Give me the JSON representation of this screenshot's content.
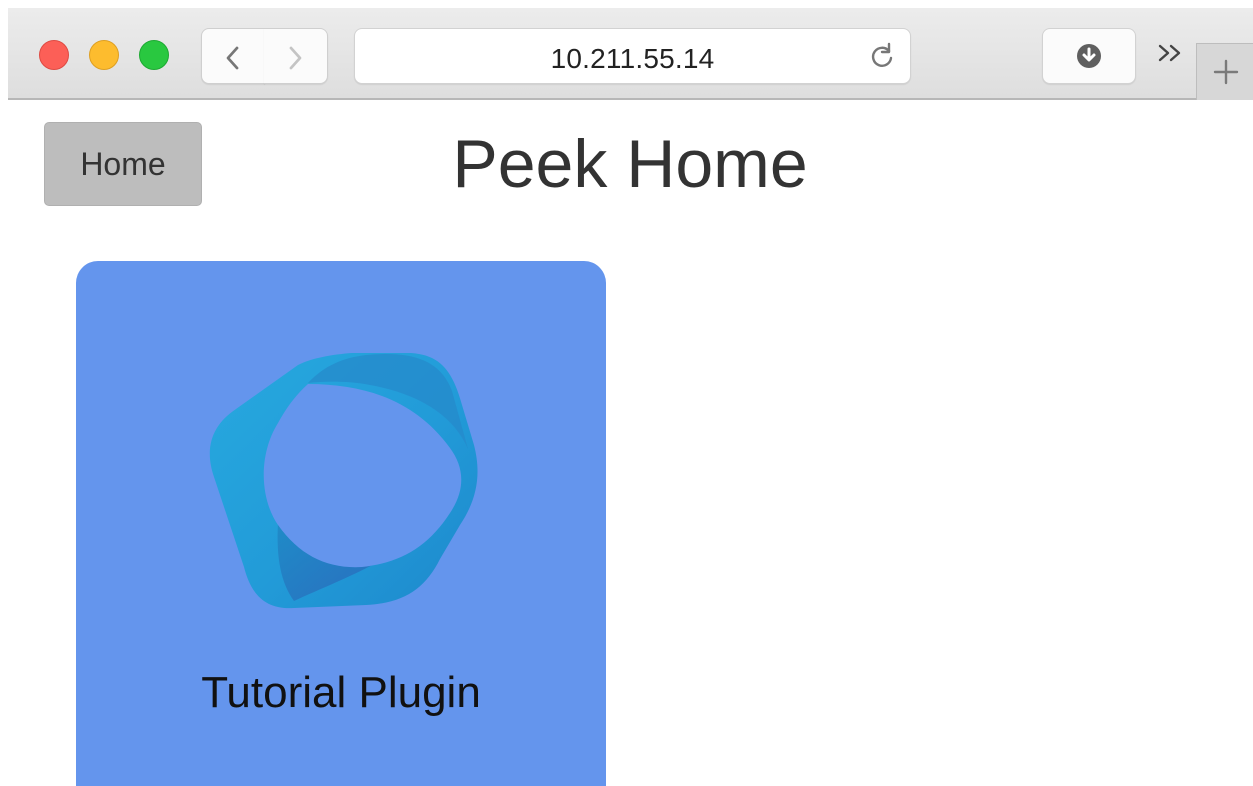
{
  "browser": {
    "address": "10.211.55.14",
    "icons": {
      "back": "chevron-left-icon",
      "forward": "chevron-right-icon",
      "reload": "reload-icon",
      "download": "download-icon",
      "overflow": "overflow-chevrons-icon",
      "new_tab": "plus-icon"
    },
    "colors": {
      "close": "#fc5f57",
      "minimize": "#fdbc2e",
      "maximize": "#29c840"
    }
  },
  "page": {
    "home_button_label": "Home",
    "title": "Peek Home",
    "plugins": [
      {
        "label": "Tutorial Plugin",
        "icon": "peek-logo-icon",
        "background": "#6495ed"
      }
    ]
  }
}
